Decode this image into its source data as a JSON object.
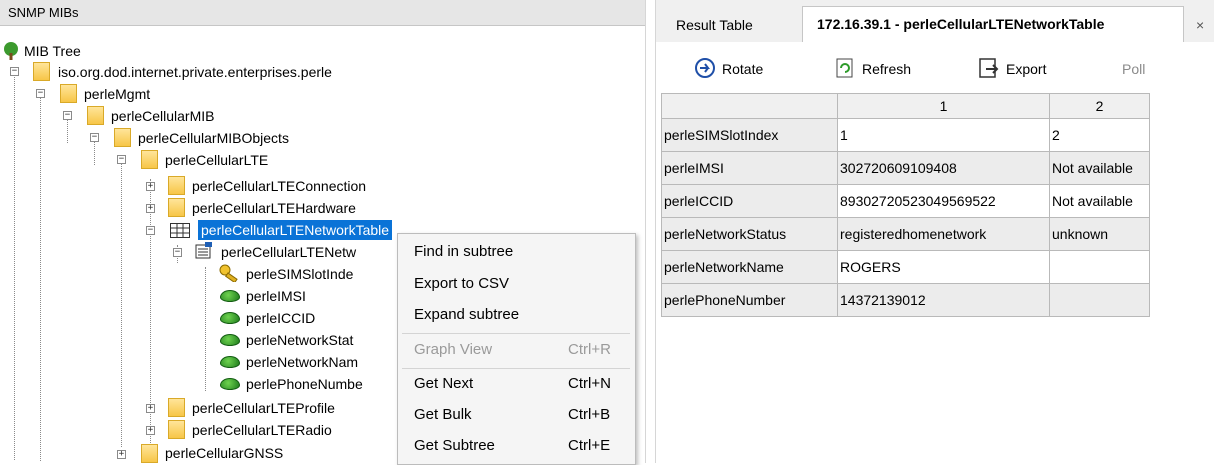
{
  "left_header": "SNMP MIBs",
  "tree": {
    "root": "MIB Tree",
    "nodes": [
      {
        "label": "iso.org.dod.internet.private.enterprises.perle"
      },
      {
        "label": "perleMgmt"
      },
      {
        "label": "perleCellularMIB"
      },
      {
        "label": "perleCellularMIBObjects"
      },
      {
        "label": "perleCellularLTE"
      },
      {
        "label": "perleCellularLTEConnection"
      },
      {
        "label": "perleCellularLTEHardware"
      },
      {
        "label": "perleCellularLTENetworkTable"
      },
      {
        "label": "perleCellularLTENetw"
      },
      {
        "label": "perleSIMSlotInde"
      },
      {
        "label": "perleIMSI"
      },
      {
        "label": "perleICCID"
      },
      {
        "label": "perleNetworkStat"
      },
      {
        "label": "perleNetworkNam"
      },
      {
        "label": "perlePhoneNumbe"
      },
      {
        "label": "perleCellularLTEProfile"
      },
      {
        "label": "perleCellularLTERadio"
      },
      {
        "label": "perleCellularGNSS"
      }
    ]
  },
  "context_menu": {
    "items": [
      {
        "label": "Find in subtree",
        "shortcut": ""
      },
      {
        "label": "Export to CSV",
        "shortcut": ""
      },
      {
        "label": "Expand subtree",
        "shortcut": ""
      },
      {
        "label": "Graph View",
        "shortcut": "Ctrl+R"
      },
      {
        "label": "Get Next",
        "shortcut": "Ctrl+N"
      },
      {
        "label": "Get Bulk",
        "shortcut": "Ctrl+B"
      },
      {
        "label": "Get Subtree",
        "shortcut": "Ctrl+E"
      }
    ]
  },
  "tabs": {
    "result_table": "Result Table",
    "active": "172.16.39.1 - perleCellularLTENetworkTable",
    "close": "×"
  },
  "toolbar": {
    "rotate": "Rotate",
    "refresh": "Refresh",
    "export": "Export",
    "poll": "Poll"
  },
  "table": {
    "columns": [
      "",
      "1",
      "2"
    ],
    "rows": [
      {
        "name": "perleSIMSlotIndex",
        "c1": "1",
        "c2": "2"
      },
      {
        "name": "perleIMSI",
        "c1": "302720609109408",
        "c2": "Not available"
      },
      {
        "name": "perleICCID",
        "c1": "89302720523049569522",
        "c2": "Not available"
      },
      {
        "name": "perleNetworkStatus",
        "c1": "registeredhomenetwork",
        "c2": "unknown"
      },
      {
        "name": "perleNetworkName",
        "c1": "ROGERS",
        "c2": ""
      },
      {
        "name": "perlePhoneNumber",
        "c1": "14372139012",
        "c2": ""
      }
    ]
  },
  "colors": {
    "selection": "#0a73d7",
    "folder": "#f7c648",
    "leaf": "#2e9b2a"
  }
}
